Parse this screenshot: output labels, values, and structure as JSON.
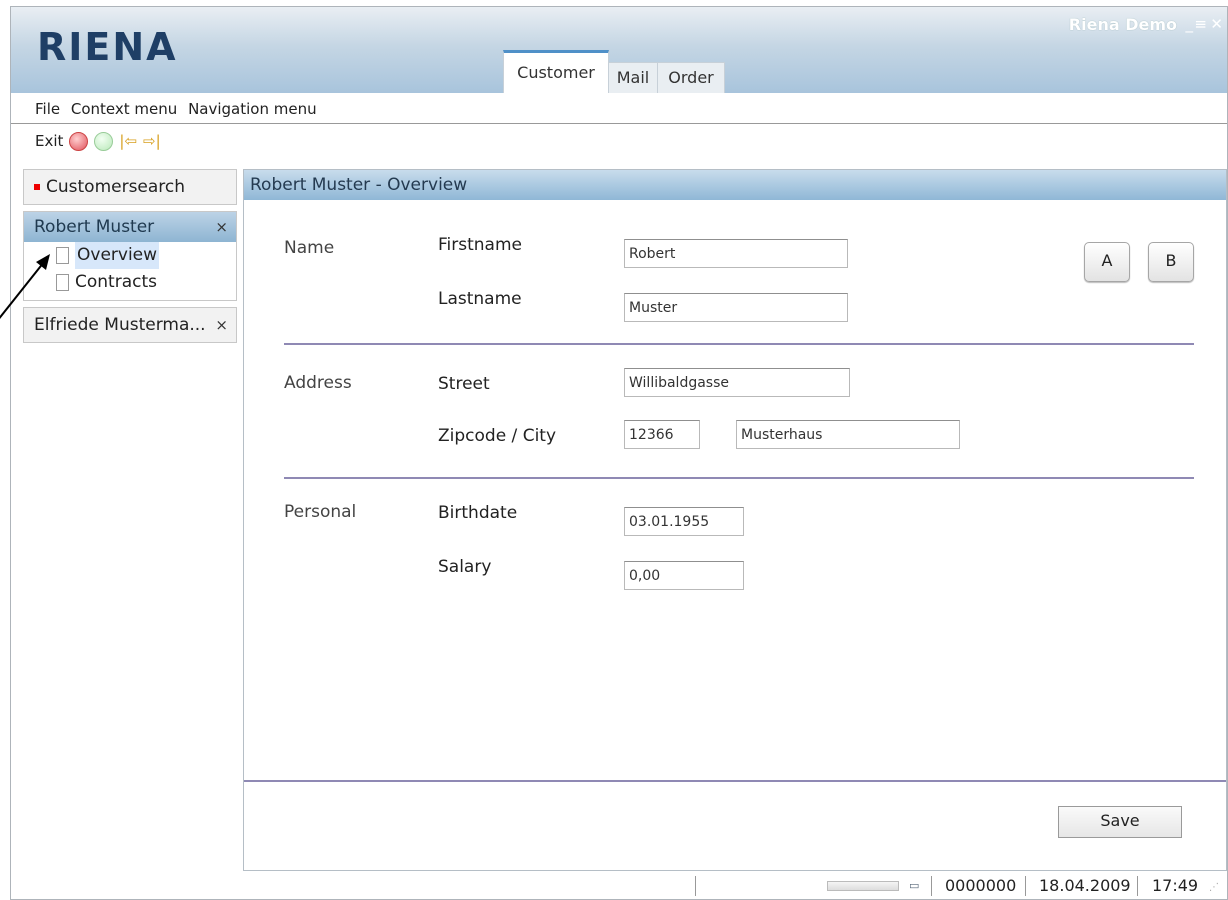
{
  "app": {
    "logo": "RIENA",
    "title": "Riena Demo",
    "minimize": "_",
    "maximize": "≡",
    "close": "✕"
  },
  "tabs": [
    {
      "label": "Customer"
    },
    {
      "label": "Mail"
    },
    {
      "label": "Order"
    }
  ],
  "menu": {
    "file": "File",
    "context": "Context menu",
    "navigation": "Navigation menu"
  },
  "toolbar": {
    "exit": "Exit",
    "back_arrow": "|⇦",
    "forward_arrow": "⇨|"
  },
  "sidebar": {
    "customersearch": "Customersearch",
    "robert_module": "Robert Muster",
    "robert_close": "×",
    "overview": "Overview",
    "contracts": "Contracts",
    "elfriede_module": "Elfriede Musterma...",
    "elfriede_close": "×"
  },
  "main": {
    "title": "Robert Muster - Overview",
    "sections": {
      "name": "Name",
      "address": "Address",
      "personal": "Personal"
    },
    "labels": {
      "firstname": "Firstname",
      "lastname": "Lastname",
      "street": "Street",
      "zip_city": "Zipcode / City",
      "birthdate": "Birthdate",
      "salary": "Salary"
    },
    "values": {
      "firstname": "Robert",
      "lastname": "Muster",
      "street": "Willibaldgasse",
      "zipcode": "12366",
      "city": "Musterhaus",
      "birthdate": "03.01.1955",
      "salary": "0,00"
    },
    "buttons": {
      "a": "A",
      "b": "B",
      "save": "Save"
    }
  },
  "status": {
    "number": "0000000",
    "date": "18.04.2009",
    "time": "17:49"
  }
}
